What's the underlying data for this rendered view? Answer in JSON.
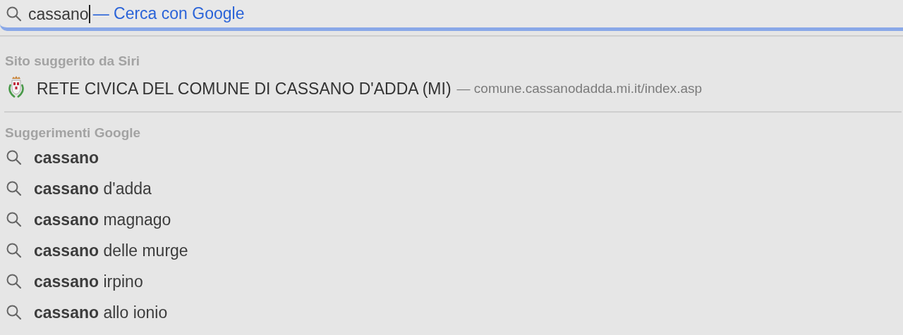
{
  "search": {
    "value": "cassano",
    "hint": "— Cerca con Google"
  },
  "siri_section": {
    "title": "Sito suggerito da Siri",
    "site": {
      "title": "RETE CIVICA DEL COMUNE DI CASSANO D'ADDA (MI)",
      "url": "— comune.cassanodadda.mi.it/index.asp"
    }
  },
  "google_section": {
    "title": "Suggerimenti Google",
    "suggestions": [
      "**cassano**",
      "**cassano** d'adda",
      "**cassano** magnago",
      "**cassano** delle murge",
      "**cassano** irpino",
      "**cassano** allo ionio"
    ]
  }
}
